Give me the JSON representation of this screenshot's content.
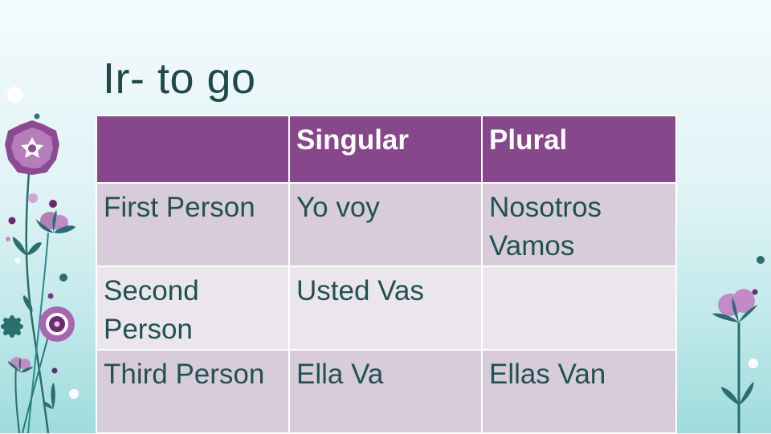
{
  "slide": {
    "title": "Ir- to go"
  },
  "table": {
    "headers": [
      "",
      "Singular",
      "Plural"
    ],
    "rows": [
      {
        "label": "First Person",
        "singular": "Yo voy",
        "plural": "Nosotros Vamos"
      },
      {
        "label": "Second Person",
        "singular": "Usted Vas",
        "plural": ""
      },
      {
        "label": "Third Person",
        "singular": "Ella Va",
        "plural": "Ellas Van"
      }
    ]
  },
  "colors": {
    "header_bg": "#87478b",
    "row_dark": "#d8ccdb",
    "row_light": "#ebe5ec",
    "text": "#1f5252",
    "title": "#1f4a4a"
  }
}
